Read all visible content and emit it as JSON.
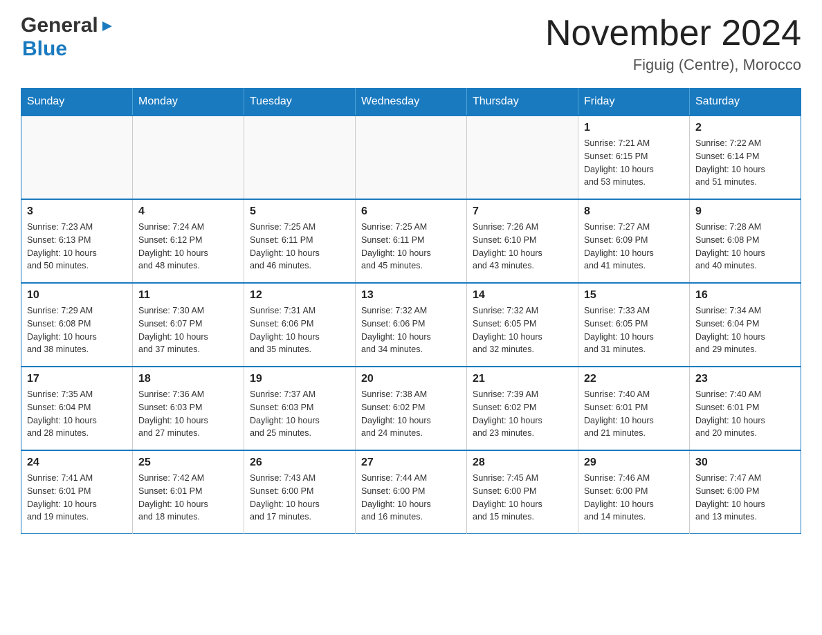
{
  "header": {
    "logo_general": "General",
    "logo_blue": "Blue",
    "month_title": "November 2024",
    "location": "Figuig (Centre), Morocco"
  },
  "days_of_week": [
    "Sunday",
    "Monday",
    "Tuesday",
    "Wednesday",
    "Thursday",
    "Friday",
    "Saturday"
  ],
  "weeks": [
    [
      {
        "day": "",
        "info": ""
      },
      {
        "day": "",
        "info": ""
      },
      {
        "day": "",
        "info": ""
      },
      {
        "day": "",
        "info": ""
      },
      {
        "day": "",
        "info": ""
      },
      {
        "day": "1",
        "info": "Sunrise: 7:21 AM\nSunset: 6:15 PM\nDaylight: 10 hours\nand 53 minutes."
      },
      {
        "day": "2",
        "info": "Sunrise: 7:22 AM\nSunset: 6:14 PM\nDaylight: 10 hours\nand 51 minutes."
      }
    ],
    [
      {
        "day": "3",
        "info": "Sunrise: 7:23 AM\nSunset: 6:13 PM\nDaylight: 10 hours\nand 50 minutes."
      },
      {
        "day": "4",
        "info": "Sunrise: 7:24 AM\nSunset: 6:12 PM\nDaylight: 10 hours\nand 48 minutes."
      },
      {
        "day": "5",
        "info": "Sunrise: 7:25 AM\nSunset: 6:11 PM\nDaylight: 10 hours\nand 46 minutes."
      },
      {
        "day": "6",
        "info": "Sunrise: 7:25 AM\nSunset: 6:11 PM\nDaylight: 10 hours\nand 45 minutes."
      },
      {
        "day": "7",
        "info": "Sunrise: 7:26 AM\nSunset: 6:10 PM\nDaylight: 10 hours\nand 43 minutes."
      },
      {
        "day": "8",
        "info": "Sunrise: 7:27 AM\nSunset: 6:09 PM\nDaylight: 10 hours\nand 41 minutes."
      },
      {
        "day": "9",
        "info": "Sunrise: 7:28 AM\nSunset: 6:08 PM\nDaylight: 10 hours\nand 40 minutes."
      }
    ],
    [
      {
        "day": "10",
        "info": "Sunrise: 7:29 AM\nSunset: 6:08 PM\nDaylight: 10 hours\nand 38 minutes."
      },
      {
        "day": "11",
        "info": "Sunrise: 7:30 AM\nSunset: 6:07 PM\nDaylight: 10 hours\nand 37 minutes."
      },
      {
        "day": "12",
        "info": "Sunrise: 7:31 AM\nSunset: 6:06 PM\nDaylight: 10 hours\nand 35 minutes."
      },
      {
        "day": "13",
        "info": "Sunrise: 7:32 AM\nSunset: 6:06 PM\nDaylight: 10 hours\nand 34 minutes."
      },
      {
        "day": "14",
        "info": "Sunrise: 7:32 AM\nSunset: 6:05 PM\nDaylight: 10 hours\nand 32 minutes."
      },
      {
        "day": "15",
        "info": "Sunrise: 7:33 AM\nSunset: 6:05 PM\nDaylight: 10 hours\nand 31 minutes."
      },
      {
        "day": "16",
        "info": "Sunrise: 7:34 AM\nSunset: 6:04 PM\nDaylight: 10 hours\nand 29 minutes."
      }
    ],
    [
      {
        "day": "17",
        "info": "Sunrise: 7:35 AM\nSunset: 6:04 PM\nDaylight: 10 hours\nand 28 minutes."
      },
      {
        "day": "18",
        "info": "Sunrise: 7:36 AM\nSunset: 6:03 PM\nDaylight: 10 hours\nand 27 minutes."
      },
      {
        "day": "19",
        "info": "Sunrise: 7:37 AM\nSunset: 6:03 PM\nDaylight: 10 hours\nand 25 minutes."
      },
      {
        "day": "20",
        "info": "Sunrise: 7:38 AM\nSunset: 6:02 PM\nDaylight: 10 hours\nand 24 minutes."
      },
      {
        "day": "21",
        "info": "Sunrise: 7:39 AM\nSunset: 6:02 PM\nDaylight: 10 hours\nand 23 minutes."
      },
      {
        "day": "22",
        "info": "Sunrise: 7:40 AM\nSunset: 6:01 PM\nDaylight: 10 hours\nand 21 minutes."
      },
      {
        "day": "23",
        "info": "Sunrise: 7:40 AM\nSunset: 6:01 PM\nDaylight: 10 hours\nand 20 minutes."
      }
    ],
    [
      {
        "day": "24",
        "info": "Sunrise: 7:41 AM\nSunset: 6:01 PM\nDaylight: 10 hours\nand 19 minutes."
      },
      {
        "day": "25",
        "info": "Sunrise: 7:42 AM\nSunset: 6:01 PM\nDaylight: 10 hours\nand 18 minutes."
      },
      {
        "day": "26",
        "info": "Sunrise: 7:43 AM\nSunset: 6:00 PM\nDaylight: 10 hours\nand 17 minutes."
      },
      {
        "day": "27",
        "info": "Sunrise: 7:44 AM\nSunset: 6:00 PM\nDaylight: 10 hours\nand 16 minutes."
      },
      {
        "day": "28",
        "info": "Sunrise: 7:45 AM\nSunset: 6:00 PM\nDaylight: 10 hours\nand 15 minutes."
      },
      {
        "day": "29",
        "info": "Sunrise: 7:46 AM\nSunset: 6:00 PM\nDaylight: 10 hours\nand 14 minutes."
      },
      {
        "day": "30",
        "info": "Sunrise: 7:47 AM\nSunset: 6:00 PM\nDaylight: 10 hours\nand 13 minutes."
      }
    ]
  ]
}
